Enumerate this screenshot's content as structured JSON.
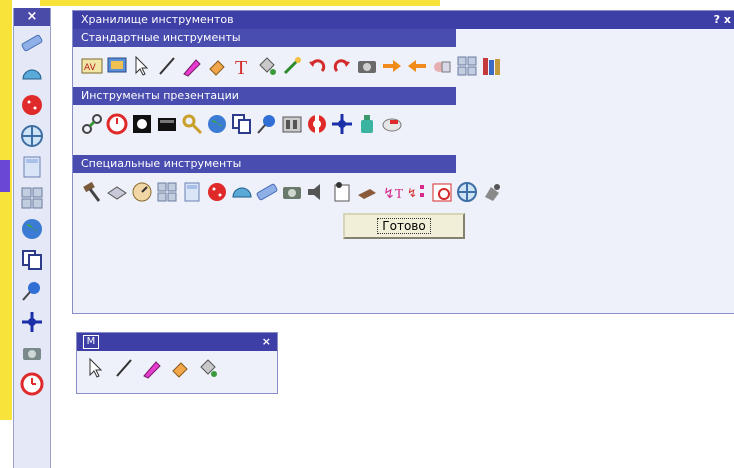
{
  "window": {
    "title": "Хранилище инструментов",
    "help_button": "?",
    "close_button": "x"
  },
  "sections": {
    "standard": {
      "title": "Стандартные инструменты"
    },
    "presentation": {
      "title": "Инструменты презентации"
    },
    "special": {
      "title": "Специальные инструменты"
    }
  },
  "done_button": "Готово",
  "side_toolbar": {
    "close": "×"
  },
  "mini_toolbar": {
    "label": "M",
    "close": "×"
  },
  "colors": {
    "title_bar": "#3e3fa6",
    "section_header": "#4a4db0",
    "panel_bg": "#eef0fa",
    "accent_yellow": "#f7e33a"
  }
}
